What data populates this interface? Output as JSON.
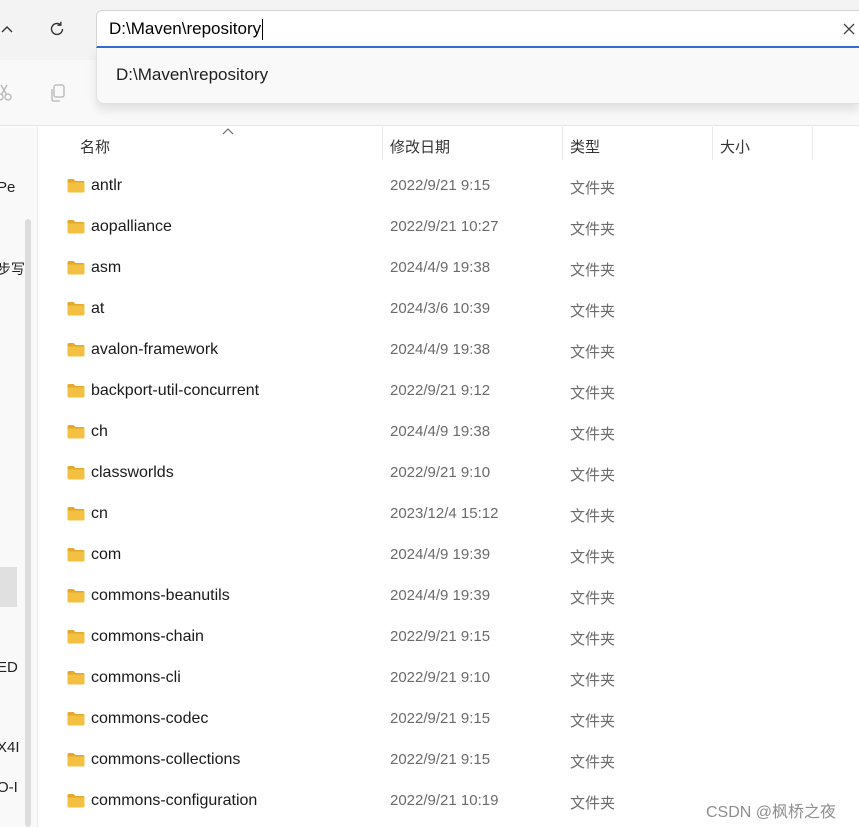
{
  "address": {
    "value": "D:\\Maven\\repository",
    "suggestion": "D:\\Maven\\repository"
  },
  "columns": {
    "name": "名称",
    "date": "修改日期",
    "type": "类型",
    "size": "大小"
  },
  "left_nav": {
    "labels": [
      "Pe",
      "步写",
      "ED",
      "X4I",
      "O-I"
    ]
  },
  "files": [
    {
      "name": "antlr",
      "date": "2022/9/21 9:15",
      "type": "文件夹"
    },
    {
      "name": "aopalliance",
      "date": "2022/9/21 10:27",
      "type": "文件夹"
    },
    {
      "name": "asm",
      "date": "2024/4/9 19:38",
      "type": "文件夹"
    },
    {
      "name": "at",
      "date": "2024/3/6 10:39",
      "type": "文件夹"
    },
    {
      "name": "avalon-framework",
      "date": "2024/4/9 19:38",
      "type": "文件夹"
    },
    {
      "name": "backport-util-concurrent",
      "date": "2022/9/21 9:12",
      "type": "文件夹"
    },
    {
      "name": "ch",
      "date": "2024/4/9 19:38",
      "type": "文件夹"
    },
    {
      "name": "classworlds",
      "date": "2022/9/21 9:10",
      "type": "文件夹"
    },
    {
      "name": "cn",
      "date": "2023/12/4 15:12",
      "type": "文件夹"
    },
    {
      "name": "com",
      "date": "2024/4/9 19:39",
      "type": "文件夹"
    },
    {
      "name": "commons-beanutils",
      "date": "2024/4/9 19:39",
      "type": "文件夹"
    },
    {
      "name": "commons-chain",
      "date": "2022/9/21 9:15",
      "type": "文件夹"
    },
    {
      "name": "commons-cli",
      "date": "2022/9/21 9:10",
      "type": "文件夹"
    },
    {
      "name": "commons-codec",
      "date": "2022/9/21 9:15",
      "type": "文件夹"
    },
    {
      "name": "commons-collections",
      "date": "2022/9/21 9:15",
      "type": "文件夹"
    },
    {
      "name": "commons-configuration",
      "date": "2022/9/21 10:19",
      "type": "文件夹"
    }
  ],
  "watermark": "CSDN @枫桥之夜",
  "icons": {
    "up": "chevron-up-icon",
    "refresh": "refresh-icon",
    "clear": "close-icon",
    "cut": "cut-icon",
    "copy": "copy-icon",
    "folder": "folder-icon",
    "sort": "sort-up-icon"
  },
  "colors": {
    "accent": "#2f6fd6",
    "folder": "#f4c042",
    "folder_dark": "#e2a92b"
  }
}
